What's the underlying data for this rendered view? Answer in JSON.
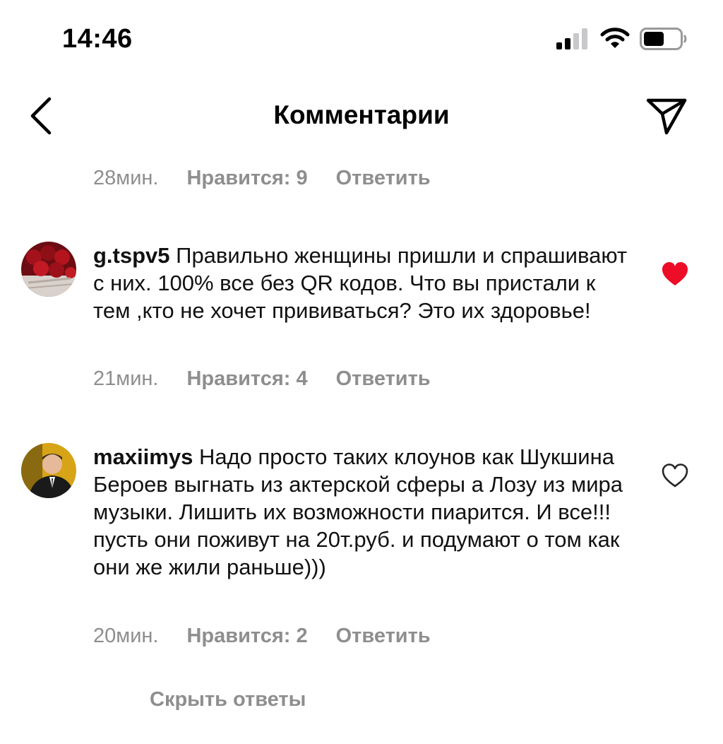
{
  "status_bar": {
    "time": "14:46",
    "signal_icon": "signal-icon",
    "wifi_icon": "wifi-icon",
    "battery_icon": "battery-icon"
  },
  "header": {
    "title": "Комментарии",
    "back_icon": "chevron-left-icon",
    "share_icon": "send-icon"
  },
  "top_meta": {
    "time_ago": "28мин.",
    "likes": "Нравится: 9",
    "reply": "Ответить"
  },
  "comments": [
    {
      "username": "g.tspv5",
      "text": "Правильно женщины пришли и спрашивают с них. 100% все без QR кодов. Что вы пристали к тем ,кто не хочет прививаться? Это их здоровье!",
      "time_ago": "21мин.",
      "likes": "Нравится: 4",
      "reply": "Ответить",
      "liked": true
    },
    {
      "username": "maxiimys",
      "text": "Надо просто таких клоунов как Шукшина Бероев выгнать из актерской сферы а Лозу из мира музыки. Лишить их возможности пиарится. И все!!! пусть они поживут на 20т.руб. и подумают о том как они же жили раньше)))",
      "time_ago": "20мин.",
      "likes": "Нравится: 2",
      "reply": "Ответить",
      "liked": false
    }
  ],
  "hide_replies": "Скрыть ответы",
  "colors": {
    "like_red": "#ed0d27",
    "muted_gray": "#8e8e8e"
  }
}
